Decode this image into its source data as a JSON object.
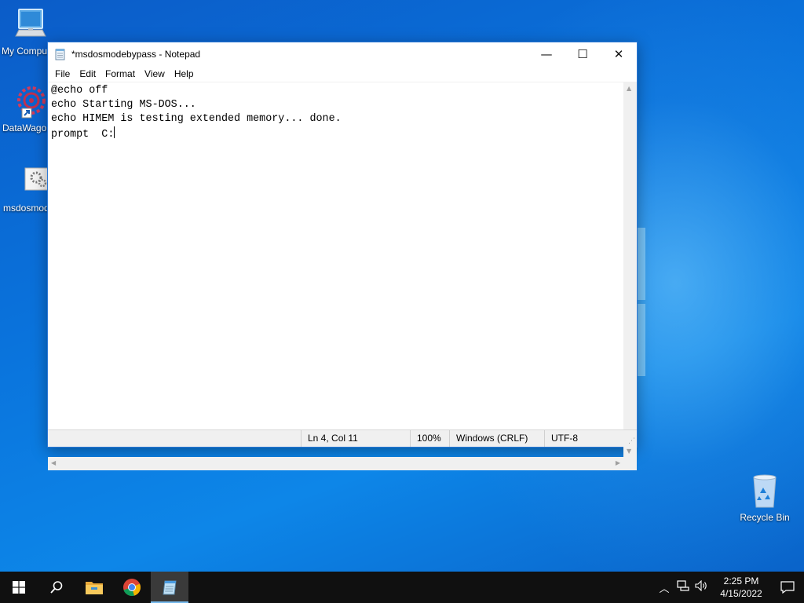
{
  "desktop": {
    "icons": [
      {
        "label": "My Computer"
      },
      {
        "label": "DataWagon"
      },
      {
        "label": "msdosmodebypass"
      },
      {
        "label": "Recycle Bin"
      }
    ]
  },
  "notepad": {
    "title": "*msdosmodebypass - Notepad",
    "menu": [
      "File",
      "Edit",
      "Format",
      "View",
      "Help"
    ],
    "lines": [
      "@echo off",
      "echo Starting MS-DOS...",
      "echo HIMEM is testing extended memory... done.",
      "prompt  C:"
    ],
    "status": {
      "position": "Ln 4, Col 11",
      "zoom": "100%",
      "line_ending": "Windows (CRLF)",
      "encoding": "UTF-8"
    },
    "controls": {
      "minimize": "—",
      "maximize": "☐",
      "close": "✕"
    }
  },
  "taskbar": {
    "icons": [
      "windows-start-icon",
      "search-icon",
      "file-explorer-icon",
      "chrome-icon",
      "notepad-icon"
    ],
    "tray": {
      "time": "2:25 PM",
      "date": "4/15/2022"
    }
  },
  "colors": {
    "accent": "#2b78d6",
    "taskbar": "#101010",
    "desktop": "#0a6fd4"
  }
}
